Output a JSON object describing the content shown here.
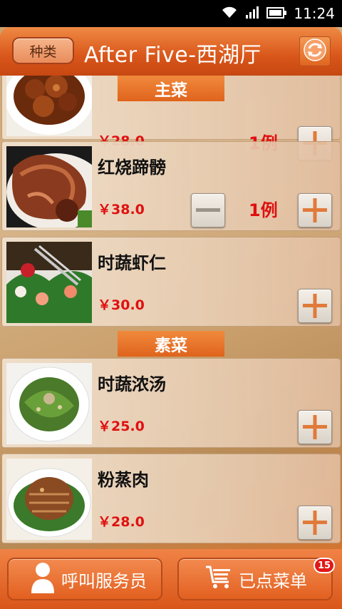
{
  "status_bar": {
    "time": "11:24"
  },
  "header": {
    "category_label": "种类",
    "title": "After Five-西湖厅",
    "refresh_icon": "refresh-icon"
  },
  "sections": [
    {
      "label": "主菜"
    },
    {
      "label": "素菜"
    }
  ],
  "dishes": [
    {
      "name": "",
      "price": "￥28.0",
      "qty": "1例",
      "image": "braised-pork"
    },
    {
      "name": "红烧蹄髈",
      "price": "￥38.0",
      "qty": "1例",
      "image": "braised-pork-knuckle"
    },
    {
      "name": "时蔬虾仁",
      "price": "￥30.0",
      "qty": "",
      "image": "vegetable-shrimp"
    },
    {
      "name": "时蔬浓汤",
      "price": "￥25.0",
      "qty": "",
      "image": "vegetable-soup"
    },
    {
      "name": "粉蒸肉",
      "price": "￥28.0",
      "qty": "",
      "image": "steamed-pork"
    }
  ],
  "bottom_bar": {
    "call_waiter_label": "呼叫服务员",
    "ordered_label": "已点菜单",
    "ordered_count": "15"
  },
  "colors": {
    "accent": "#e0631c",
    "price": "#e01010"
  }
}
